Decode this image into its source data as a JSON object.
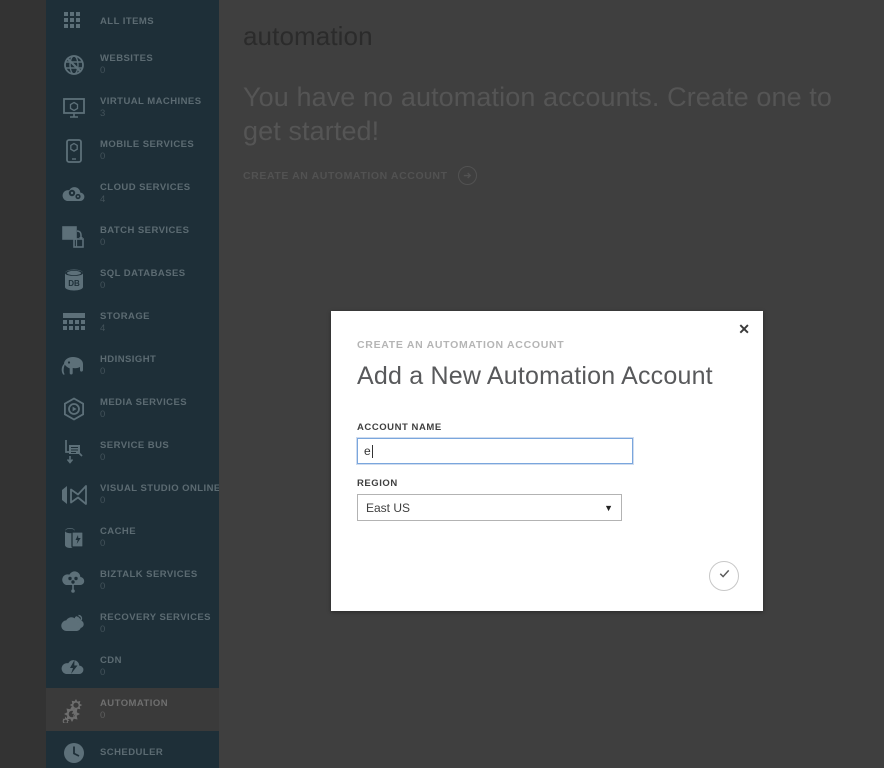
{
  "colors": {
    "sidebar_bg": "#1e2f38",
    "rail_bg": "#333333",
    "content_overlay": "#3f3f3f",
    "modal_bg": "#ffffff",
    "input_focus_border": "#7aa6dd",
    "active_item_bg": "#3a3a3a"
  },
  "sidebar": {
    "items": [
      {
        "label": "ALL ITEMS",
        "count": "",
        "icon": "grid-icon",
        "active": false
      },
      {
        "label": "WEBSITES",
        "count": "0",
        "icon": "globe-icon",
        "active": false
      },
      {
        "label": "VIRTUAL MACHINES",
        "count": "3",
        "icon": "monitor-icon",
        "active": false
      },
      {
        "label": "MOBILE SERVICES",
        "count": "0",
        "icon": "phone-icon",
        "active": false
      },
      {
        "label": "CLOUD SERVICES",
        "count": "4",
        "icon": "cloud-gears-icon",
        "active": false
      },
      {
        "label": "BATCH SERVICES",
        "count": "0",
        "icon": "batch-icon",
        "active": false
      },
      {
        "label": "SQL DATABASES",
        "count": "0",
        "icon": "database-icon",
        "active": false
      },
      {
        "label": "STORAGE",
        "count": "4",
        "icon": "table-icon",
        "active": false
      },
      {
        "label": "HDINSIGHT",
        "count": "0",
        "icon": "elephant-icon",
        "active": false
      },
      {
        "label": "MEDIA SERVICES",
        "count": "0",
        "icon": "media-play-icon",
        "active": false
      },
      {
        "label": "SERVICE BUS",
        "count": "0",
        "icon": "service-bus-icon",
        "active": false
      },
      {
        "label": "VISUAL STUDIO ONLINE",
        "count": "0",
        "icon": "visual-studio-icon",
        "active": false
      },
      {
        "label": "CACHE",
        "count": "0",
        "icon": "cache-icon",
        "active": false
      },
      {
        "label": "BIZTALK SERVICES",
        "count": "0",
        "icon": "biztalk-icon",
        "active": false
      },
      {
        "label": "RECOVERY SERVICES",
        "count": "0",
        "icon": "recovery-cloud-icon",
        "active": false
      },
      {
        "label": "CDN",
        "count": "0",
        "icon": "cdn-cloud-icon",
        "active": false
      },
      {
        "label": "AUTOMATION",
        "count": "0",
        "icon": "automation-gear-icon",
        "active": true
      },
      {
        "label": "SCHEDULER",
        "count": "",
        "icon": "clock-icon",
        "active": false
      }
    ]
  },
  "main": {
    "page_title": "automation",
    "empty_message": "You have no automation accounts. Create one to get started!",
    "create_link_label": "CREATE AN AUTOMATION ACCOUNT",
    "create_link_icon": "arrow-right-circle-icon"
  },
  "modal": {
    "close_icon": "close-icon",
    "eyebrow": "CREATE AN AUTOMATION ACCOUNT",
    "title": "Add a New Automation Account",
    "account_name": {
      "label": "ACCOUNT NAME",
      "value": "e",
      "placeholder": ""
    },
    "region": {
      "label": "REGION",
      "selected": "East US",
      "caret_icon": "chevron-down-icon"
    },
    "confirm": {
      "icon": "checkmark-icon",
      "label": ""
    }
  }
}
